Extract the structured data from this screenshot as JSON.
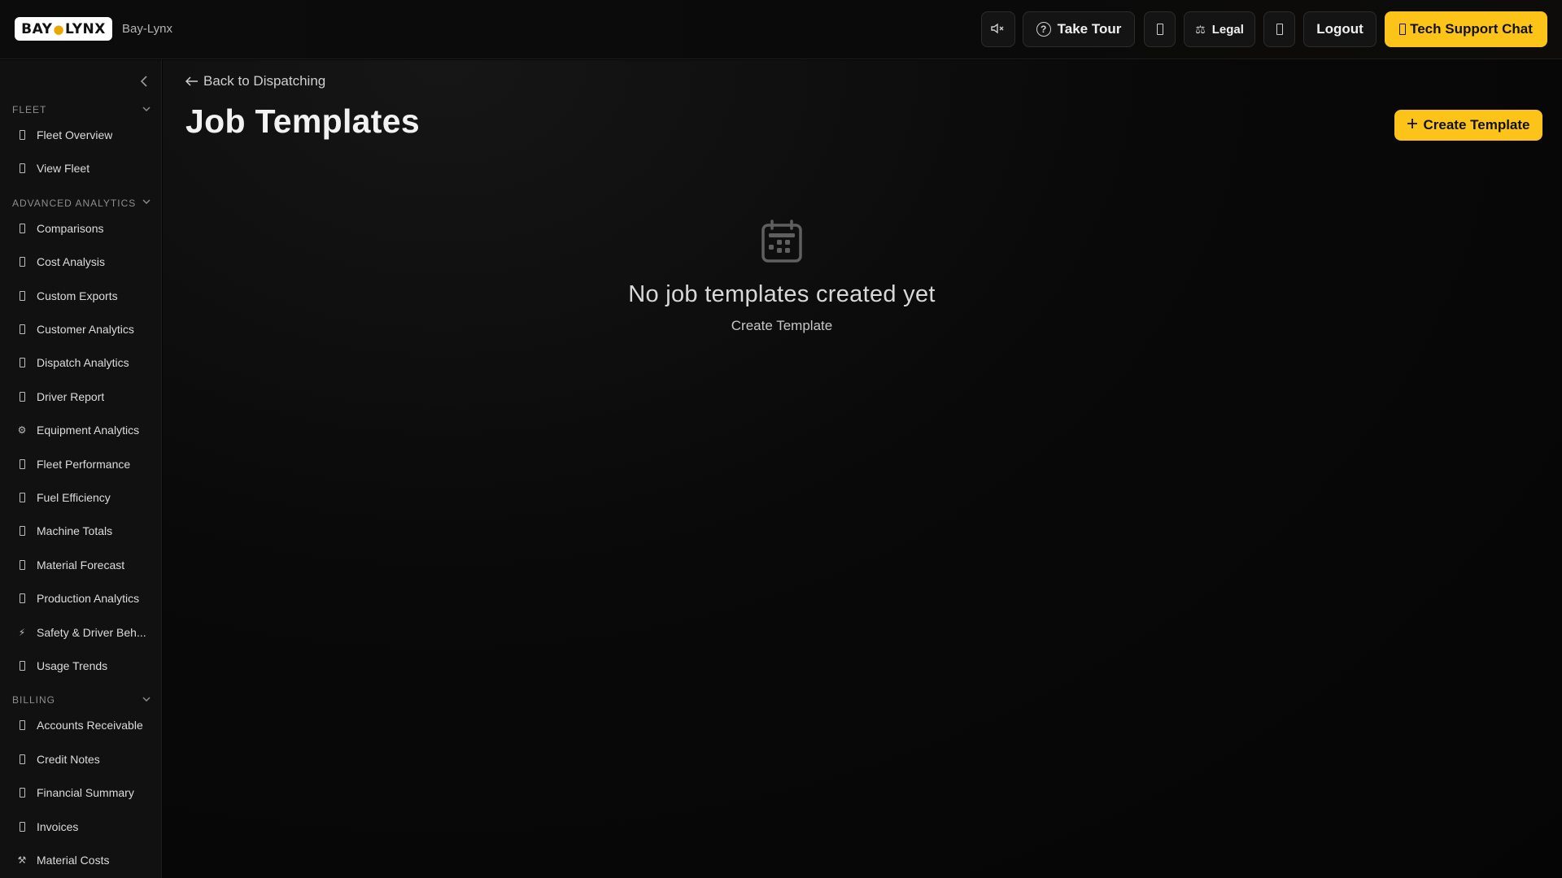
{
  "app": {
    "logo_text_left": "BAY",
    "logo_text_right": "LYNX",
    "brand_name": "Bay-Lynx"
  },
  "topbar": {
    "take_tour": "Take Tour",
    "legal": "Legal",
    "logout": "Logout",
    "support": "Tech Support Chat"
  },
  "sidebar": {
    "sections": [
      {
        "title": "FLEET",
        "items": [
          {
            "label": "Fleet Overview",
            "icon": "rect"
          },
          {
            "label": "View Fleet",
            "icon": "rect"
          }
        ]
      },
      {
        "title": "ADVANCED ANALYTICS",
        "items": [
          {
            "label": "Comparisons",
            "icon": "rect"
          },
          {
            "label": "Cost Analysis",
            "icon": "rect"
          },
          {
            "label": "Custom Exports",
            "icon": "rect"
          },
          {
            "label": "Customer Analytics",
            "icon": "rect"
          },
          {
            "label": "Dispatch Analytics",
            "icon": "rect"
          },
          {
            "label": "Driver Report",
            "icon": "rect"
          },
          {
            "label": "Equipment Analytics",
            "icon": "gear"
          },
          {
            "label": "Fleet Performance",
            "icon": "rect"
          },
          {
            "label": "Fuel Efficiency",
            "icon": "rect"
          },
          {
            "label": "Machine Totals",
            "icon": "rect"
          },
          {
            "label": "Material Forecast",
            "icon": "rect"
          },
          {
            "label": "Production Analytics",
            "icon": "rect"
          },
          {
            "label": "Safety & Driver Beh...",
            "icon": "bolt"
          },
          {
            "label": "Usage Trends",
            "icon": "rect"
          }
        ]
      },
      {
        "title": "BILLING",
        "items": [
          {
            "label": "Accounts Receivable",
            "icon": "rect"
          },
          {
            "label": "Credit Notes",
            "icon": "rect"
          },
          {
            "label": "Financial Summary",
            "icon": "rect"
          },
          {
            "label": "Invoices",
            "icon": "rect"
          },
          {
            "label": "Material Costs",
            "icon": "hammer"
          }
        ]
      }
    ]
  },
  "main": {
    "back_link": "Back to Dispatching",
    "title": "Job Templates",
    "create_button": "Create Template",
    "empty_title": "No job templates created yet",
    "empty_action": "Create Template"
  },
  "colors": {
    "accent": "#fcc419",
    "background": "#050505",
    "sidebar": "#111111"
  }
}
